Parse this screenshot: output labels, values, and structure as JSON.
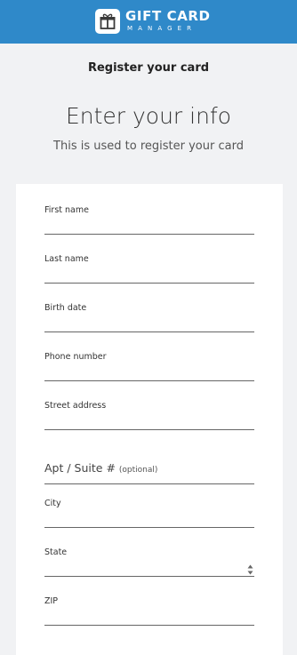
{
  "brand": {
    "title": "GIFT CARD",
    "subtitle": "MANAGER",
    "icon": "gift-icon"
  },
  "header": {
    "step_title": "Register your card"
  },
  "main": {
    "heading": "Enter your info",
    "subtitle": "This is used to register your card"
  },
  "form": {
    "first_name_label": "First name",
    "last_name_label": "Last name",
    "birth_date_label": "Birth date",
    "phone_label": "Phone number",
    "street_label": "Street address",
    "apt_label": "Apt / Suite #",
    "apt_optional": "(optional)",
    "city_label": "City",
    "state_label": "State",
    "zip_label": "ZIP"
  },
  "colors": {
    "brand_blue": "#2f89c9",
    "background": "#f1f2f4"
  }
}
